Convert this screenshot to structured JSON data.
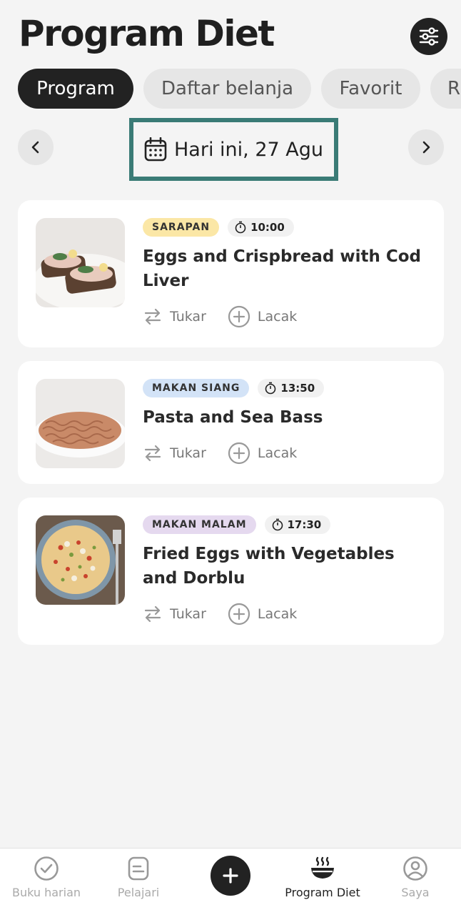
{
  "header": {
    "title": "Program Diet",
    "filter_icon": "sliders-icon"
  },
  "tabs": [
    {
      "label": "Program",
      "active": true
    },
    {
      "label": "Daftar belanja",
      "active": false
    },
    {
      "label": "Favorit",
      "active": false
    },
    {
      "label": "R",
      "active": false
    }
  ],
  "date_nav": {
    "label": "Hari ini, 27 Agu",
    "icon": "calendar-icon",
    "prev_icon": "chevron-left-icon",
    "next_icon": "chevron-right-icon"
  },
  "meals": [
    {
      "type": "SARAPAN",
      "type_color": "#fbe7a6",
      "time": "10:00",
      "name": "Eggs and Crispbread with Cod Liver",
      "swap_label": "Tukar",
      "track_label": "Lacak"
    },
    {
      "type": "MAKAN SIANG",
      "type_color": "#d3e3f7",
      "time": "13:50",
      "name": "Pasta and Sea Bass",
      "swap_label": "Tukar",
      "track_label": "Lacak"
    },
    {
      "type": "MAKAN MALAM",
      "type_color": "#e5d9ef",
      "time": "17:30",
      "name": "Fried Eggs with Vegetables and Dorblu",
      "swap_label": "Tukar",
      "track_label": "Lacak"
    }
  ],
  "bottom_nav": [
    {
      "label": "Buku harian",
      "icon": "check-circle-icon",
      "active": false
    },
    {
      "label": "Pelajari",
      "icon": "document-icon",
      "active": false
    },
    {
      "label": "Program Diet",
      "icon": "food-bowl-icon",
      "active": true
    },
    {
      "label": "Saya",
      "icon": "user-icon",
      "active": false
    }
  ],
  "add_button_icon": "plus-icon"
}
